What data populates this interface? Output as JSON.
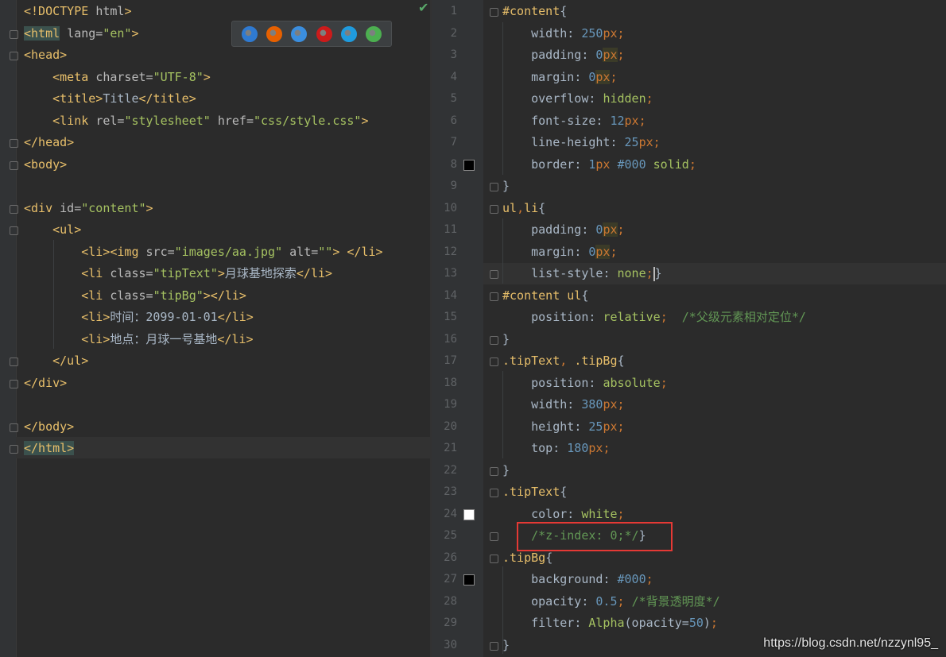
{
  "left_editor": {
    "lines": [
      {
        "html": "<span class='tag'>&lt;!DOCTYPE</span> <span class='attr'>html</span><span class='tag'>&gt;</span>"
      },
      {
        "html": "<span class='tag tag-hl'>&lt;html</span> <span class='attr'>lang=</span><span class='str'>\"en\"</span><span class='tag'>&gt;</span>"
      },
      {
        "html": "<span class='tag'>&lt;head&gt;</span>"
      },
      {
        "html": "    <span class='tag'>&lt;meta</span> <span class='attr'>charset=</span><span class='str'>\"UTF-8\"</span><span class='tag'>&gt;</span>"
      },
      {
        "html": "    <span class='tag'>&lt;title&gt;</span><span class='txt'>Title</span><span class='tag'>&lt;/title&gt;</span>"
      },
      {
        "html": "    <span class='tag'>&lt;link</span> <span class='attr'>rel=</span><span class='str'>\"stylesheet\"</span> <span class='attr'>href=</span><span class='str'>\"css/style.css\"</span><span class='tag'>&gt;</span>"
      },
      {
        "html": "<span class='tag'>&lt;/head&gt;</span>"
      },
      {
        "html": "<span class='tag'>&lt;body&gt;</span>"
      },
      {
        "html": ""
      },
      {
        "html": "<span class='tag'>&lt;div</span> <span class='attr'>id=</span><span class='str'>\"content\"</span><span class='tag'>&gt;</span>"
      },
      {
        "html": "    <span class='tag'>&lt;ul&gt;</span>"
      },
      {
        "html": "        <span class='tag'>&lt;li&gt;&lt;img</span> <span class='attr'>src=</span><span class='str'>\"images/aa.jpg\"</span> <span class='attr'>alt=</span><span class='str'>\"\"</span><span class='tag'>&gt;</span> <span class='tag'>&lt;/li&gt;</span>"
      },
      {
        "html": "        <span class='tag'>&lt;li</span> <span class='attr'>class=</span><span class='str'>\"tipText\"</span><span class='tag'>&gt;</span><span class='txt'>月球基地探索</span><span class='tag'>&lt;/li&gt;</span>"
      },
      {
        "html": "        <span class='tag'>&lt;li</span> <span class='attr'>class=</span><span class='str'>\"tipBg\"</span><span class='tag'>&gt;&lt;/li&gt;</span>"
      },
      {
        "html": "        <span class='tag'>&lt;li&gt;</span><span class='txt'>时间：2099-01-01</span><span class='tag'>&lt;/li&gt;</span>"
      },
      {
        "html": "        <span class='tag'>&lt;li&gt;</span><span class='txt'>地点：月球一号基地</span><span class='tag'>&lt;/li&gt;</span>"
      },
      {
        "html": "    <span class='tag'>&lt;/ul&gt;</span>"
      },
      {
        "html": "<span class='tag'>&lt;/div&gt;</span>"
      },
      {
        "html": ""
      },
      {
        "html": "<span class='tag'>&lt;/body&gt;</span>"
      },
      {
        "html": "<span class='tag tag-hl'>&lt;/html&gt;</span>"
      }
    ]
  },
  "right_editor": {
    "lines": [
      {
        "n": "1",
        "html": "<span class='sel'>#content</span><span class='txt'>{</span>"
      },
      {
        "n": "2",
        "html": "    <span class='prop'>width</span><span class='txt'>: </span><span class='num'>250</span><span class='unit'>px</span><span class='punc'>;</span>"
      },
      {
        "n": "3",
        "html": "    <span class='prop'>padding</span><span class='txt'>: </span><span class='num'>0</span><span class='unit hl-unit'>px</span><span class='punc'>;</span>"
      },
      {
        "n": "4",
        "html": "    <span class='prop'>margin</span><span class='txt'>: </span><span class='num'>0</span><span class='unit hl-unit'>px</span><span class='punc'>;</span>"
      },
      {
        "n": "5",
        "html": "    <span class='prop'>overflow</span><span class='txt'>: </span><span class='kw'>hidden</span><span class='punc'>;</span>"
      },
      {
        "n": "6",
        "html": "    <span class='prop'>font-size</span><span class='txt'>: </span><span class='num'>12</span><span class='unit'>px</span><span class='punc'>;</span>"
      },
      {
        "n": "7",
        "html": "    <span class='prop'>line-height</span><span class='txt'>: </span><span class='num'>25</span><span class='unit'>px</span><span class='punc'>;</span>"
      },
      {
        "n": "8",
        "html": "    <span class='prop'>border</span><span class='txt'>: </span><span class='num'>1</span><span class='unit'>px</span> <span class='hex'>#000</span> <span class='kw'>solid</span><span class='punc'>;</span>"
      },
      {
        "n": "9",
        "html": "<span class='txt'>}</span>"
      },
      {
        "n": "10",
        "html": "<span class='sel'>ul</span><span class='punc'>,</span><span class='sel'>li</span><span class='txt'>{</span>"
      },
      {
        "n": "11",
        "html": "    <span class='prop'>padding</span><span class='txt'>: </span><span class='num'>0</span><span class='unit hl-unit'>px</span><span class='punc'>;</span>"
      },
      {
        "n": "12",
        "html": "    <span class='prop'>margin</span><span class='txt'>: </span><span class='num'>0</span><span class='unit hl-unit'>px</span><span class='punc'>;</span>"
      },
      {
        "n": "13",
        "html": "    <span class='prop'>list-style</span><span class='txt'>: </span><span class='kw'>none</span><span class='punc'>;</span><span class='caret'></span><span class='txt'>}</span>"
      },
      {
        "n": "14",
        "html": "<span class='sel'>#content</span> <span class='sel'>ul</span><span class='txt'>{</span>"
      },
      {
        "n": "15",
        "html": "    <span class='prop'>position</span><span class='txt'>: </span><span class='kw'>relative</span><span class='punc'>;</span>  <span class='cmt'>/*父级元素相对定位*/</span>"
      },
      {
        "n": "16",
        "html": "<span class='txt'>}</span>"
      },
      {
        "n": "17",
        "html": "<span class='sel'>.tipText</span><span class='punc'>,</span> <span class='sel'>.tipBg</span><span class='txt'>{</span>"
      },
      {
        "n": "18",
        "html": "    <span class='prop'>position</span><span class='txt'>: </span><span class='kw'>absolute</span><span class='punc'>;</span>"
      },
      {
        "n": "19",
        "html": "    <span class='prop'>width</span><span class='txt'>: </span><span class='num'>380</span><span class='unit'>px</span><span class='punc'>;</span>"
      },
      {
        "n": "20",
        "html": "    <span class='prop'>height</span><span class='txt'>: </span><span class='num'>25</span><span class='unit'>px</span><span class='punc'>;</span>"
      },
      {
        "n": "21",
        "html": "    <span class='prop'>top</span><span class='txt'>: </span><span class='num'>180</span><span class='unit'>px</span><span class='punc'>;</span>"
      },
      {
        "n": "22",
        "html": "<span class='txt'>}</span>"
      },
      {
        "n": "23",
        "html": "<span class='sel'>.tipText</span><span class='txt'>{</span>"
      },
      {
        "n": "24",
        "html": "    <span class='prop'>color</span><span class='txt'>: </span><span class='kw'>white</span><span class='punc'>;</span>"
      },
      {
        "n": "25",
        "html": "    <span class='cmt'>/*z-index: 0;*/</span><span class='txt'>}</span>"
      },
      {
        "n": "26",
        "html": "<span class='sel'>.tipBg</span><span class='txt'>{</span>"
      },
      {
        "n": "27",
        "html": "    <span class='prop'>background</span><span class='txt'>: </span><span class='hex'>#000</span><span class='punc'>;</span>"
      },
      {
        "n": "28",
        "html": "    <span class='prop'>opacity</span><span class='txt'>: </span><span class='num'>0.5</span><span class='punc'>;</span> <span class='cmt'>/*背景透明度*/</span>"
      },
      {
        "n": "29",
        "html": "    <span class='prop'>filter</span><span class='txt'>: </span><span class='kw'>Alpha</span><span class='txt'>(opacity=</span><span class='num'>50</span><span class='txt'>)</span><span class='punc'>;</span>"
      },
      {
        "n": "30",
        "html": "<span class='txt'>}</span>"
      }
    ]
  },
  "browser_icons": [
    {
      "name": "edge-icon",
      "color": "#2f7ad1"
    },
    {
      "name": "firefox-icon",
      "color": "#e66000"
    },
    {
      "name": "safari-icon",
      "color": "#3b8ede"
    },
    {
      "name": "opera-icon",
      "color": "#cc1b1b"
    },
    {
      "name": "ie-icon",
      "color": "#1f9bde"
    },
    {
      "name": "chrome-icon",
      "color": "#4caf50"
    }
  ],
  "color_swatches": [
    {
      "line": "8",
      "color": "#000000"
    },
    {
      "line": "24",
      "color": "#ffffff"
    },
    {
      "line": "27",
      "color": "#000000"
    }
  ],
  "watermark": "https://blog.csdn.net/nzzynl95_"
}
